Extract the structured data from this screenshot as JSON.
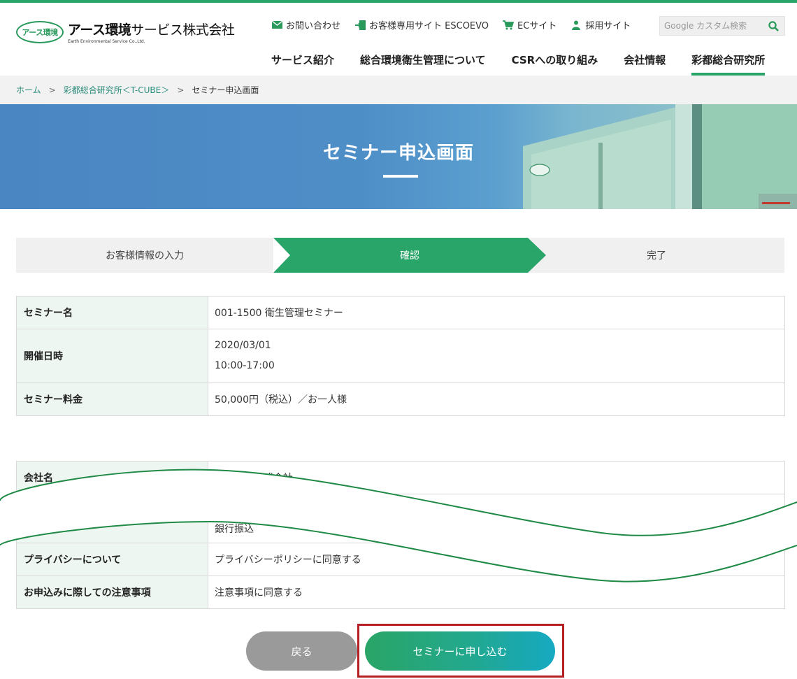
{
  "brand": {
    "badge": "アース環境",
    "name_bold": "アース環境",
    "name_light": "サービス株式会社",
    "sub": "Earth Environmental Service Co.,Ltd."
  },
  "utility": {
    "contact": "お問い合わせ",
    "customer_site": "お客様専用サイト ESCOEVO",
    "ec_site": "ECサイト",
    "recruit": "採用サイト",
    "search_placeholder": "Google カスタム検索"
  },
  "nav": {
    "items": [
      "サービス紹介",
      "総合環境衛生管理について",
      "CSRへの取り組み",
      "会社情報",
      "彩都総合研究所"
    ],
    "active_index": 4
  },
  "breadcrumb": {
    "home": "ホーム",
    "parent": "彩都総合研究所＜T-CUBE＞",
    "current": "セミナー申込画面",
    "separator": ">"
  },
  "hero": {
    "title": "セミナー申込画面"
  },
  "steps": {
    "items": [
      "お客様情報の入力",
      "確認",
      "完了"
    ],
    "active_index": 1
  },
  "seminar": {
    "name_label": "セミナー名",
    "name_value": "001-1500 衛生管理セミナー",
    "date_label": "開催日時",
    "date_value": "2020/03/01",
    "time_value": "10:00-17:00",
    "fee_label": "セミナー料金",
    "fee_value": "50,000円（税込）／お一人様"
  },
  "applicant": {
    "company_label": "会社名",
    "company_value": "〇〇食品株式会社",
    "middle_value": "銀行振込",
    "privacy_label": "プライバシーについて",
    "privacy_value": "プライバシーポリシーに同意する",
    "notice_label": "お申込みに際しての注意事項",
    "notice_value": "注意事項に同意する"
  },
  "actions": {
    "back": "戻る",
    "submit": "セミナーに申し込む"
  },
  "colors": {
    "brand_green": "#2aa56a",
    "highlight_red": "#b52025",
    "link": "#2a8c7a"
  }
}
